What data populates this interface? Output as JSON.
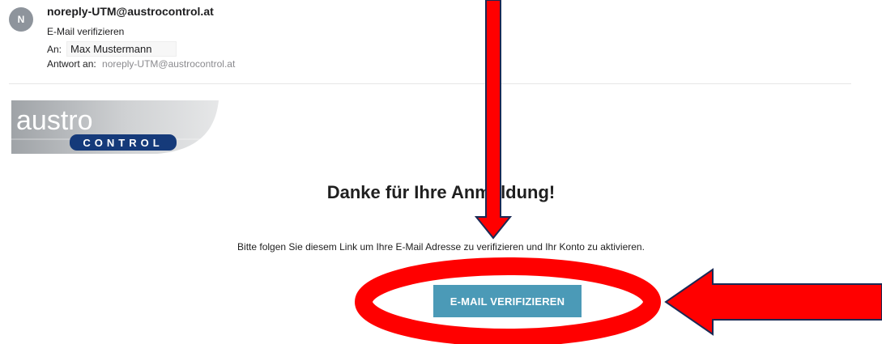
{
  "email": {
    "avatar_initial": "N",
    "sender": "noreply-UTM@austrocontrol.at",
    "subject": "E-Mail verifizieren",
    "to_label": "An:",
    "to_name": "Max Mustermann",
    "reply_label": "Antwort an:",
    "reply_address": "noreply-UTM@austrocontrol.at"
  },
  "logo": {
    "word_top": "austro",
    "word_bottom": "CONTROL",
    "colors": {
      "banner_gray": "#c8cacc",
      "navy": "#153a7a"
    }
  },
  "content": {
    "heading": "Danke für Ihre Anmeldung!",
    "instruction": "Bitte folgen Sie diesem Link um Ihre E-Mail Adresse zu verifizieren und Ihr Konto zu aktivieren.",
    "button_label": "E-MAIL VERIFIZIEREN"
  },
  "annotations": {
    "colors": {
      "arrow_fill": "#ff0000",
      "arrow_outline": "#1a2a55",
      "ellipse": "#ff0000"
    }
  }
}
